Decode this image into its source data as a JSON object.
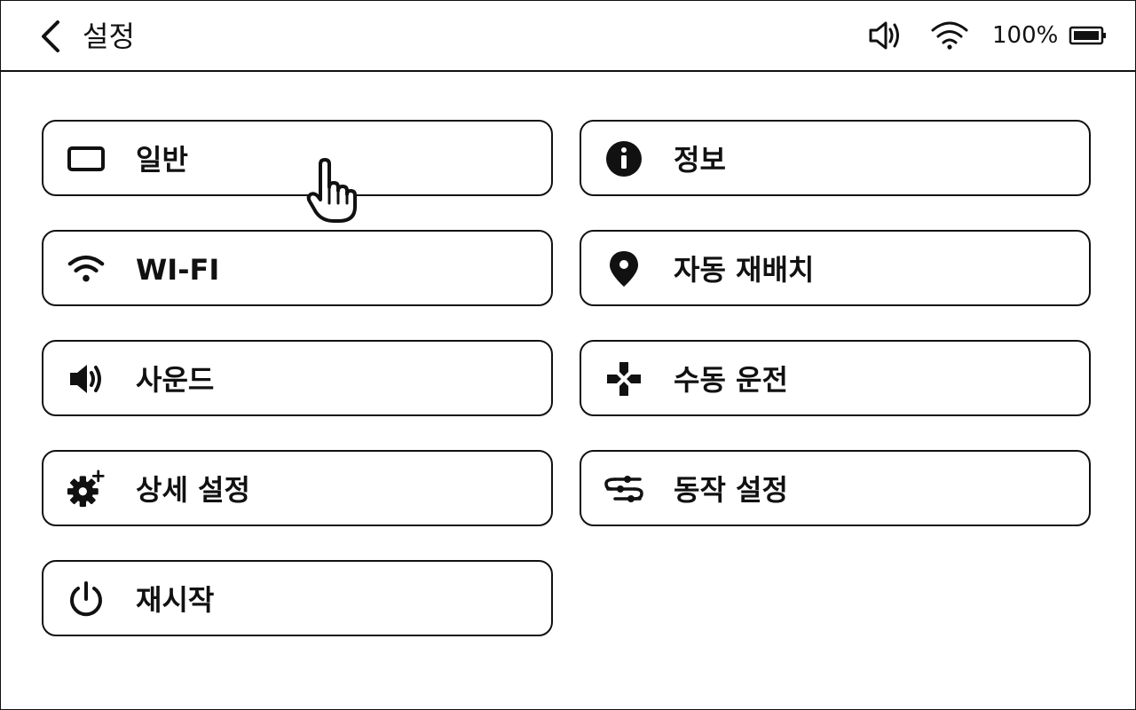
{
  "header": {
    "title": "설정",
    "battery_text": "100%"
  },
  "menu": {
    "general": "일반",
    "info": "정보",
    "wifi": "WI-FI",
    "auto_relocate": "자동 재배치",
    "sound": "사운드",
    "manual_drive": "수동 운전",
    "advanced_settings": "상세 설정",
    "motion_settings": "동작 설정",
    "restart": "재시작"
  },
  "icons": {
    "general": "display-icon",
    "info": "info-icon",
    "wifi": "wifi-icon",
    "auto_relocate": "location-pin-icon",
    "sound": "speaker-icon",
    "manual_drive": "dpad-icon",
    "advanced_settings": "gear-plus-icon",
    "motion_settings": "sliders-icon",
    "restart": "power-icon"
  },
  "colors": {
    "foreground": "#111111",
    "background": "#ffffff"
  }
}
